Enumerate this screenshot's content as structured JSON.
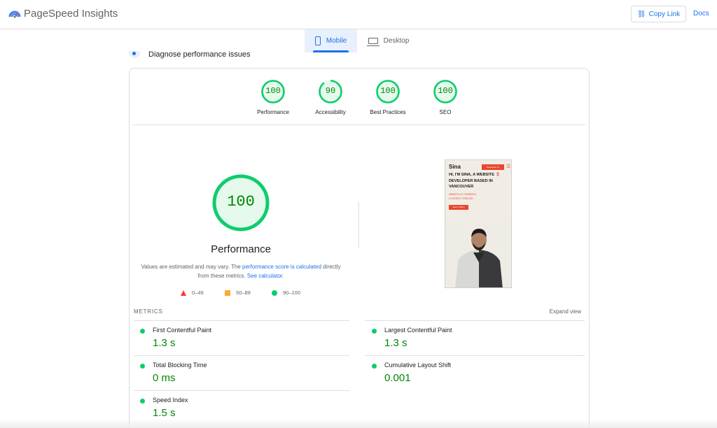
{
  "header": {
    "brand": "PageSpeed Insights",
    "copy_link_label": "Copy Link",
    "docs_label": "Docs"
  },
  "tabs": [
    {
      "label": "Mobile",
      "selected": true
    },
    {
      "label": "Desktop",
      "selected": false
    }
  ],
  "section_title": "Diagnose performance issues",
  "categories": [
    {
      "score": "100",
      "label": "Performance",
      "score_value": 100
    },
    {
      "score": "90",
      "label": "Accessibility",
      "score_value": 90
    },
    {
      "score": "100",
      "label": "Best Practices",
      "score_value": 100
    },
    {
      "score": "100",
      "label": "SEO",
      "score_value": 100
    }
  ],
  "main_score": {
    "score": "100",
    "score_value": 100,
    "title": "Performance",
    "note_prefix": "Values are estimated and may vary. The ",
    "note_link1": "performance score is calculated",
    "note_middle": " directly from these metrics. ",
    "note_link2": "See calculator."
  },
  "legend": [
    {
      "range": "0–49",
      "color": "#ff3333"
    },
    {
      "range": "50–89",
      "color": "#ffaa33"
    },
    {
      "range": "90–100",
      "color": "#0cce6b"
    }
  ],
  "thumbnail": {
    "logo": "Sina",
    "button": "Download CV",
    "menu": "☰",
    "headline": "HI, I'M SINA, A WEBSITE 🌷 DEVELOPER BASED IN VANCOUVER",
    "sub1": "WEBSITE",
    "sub2": "E-COMMERCE",
    "sub3": "CONTENT CREATION",
    "cta": "Get in Touch"
  },
  "metrics_section": {
    "label": "METRICS",
    "expand_label": "Expand view"
  },
  "metrics": [
    {
      "name": "First Contentful Paint",
      "value": "1.3 s"
    },
    {
      "name": "Largest Contentful Paint",
      "value": "1.3 s"
    },
    {
      "name": "Total Blocking Time",
      "value": "0 ms"
    },
    {
      "name": "Cumulative Layout Shift",
      "value": "0.001"
    },
    {
      "name": "Speed Index",
      "value": "1.5 s"
    }
  ],
  "colors": {
    "pass": "#0cce6b",
    "pass_text": "#008800",
    "accent": "#1a73e8"
  }
}
